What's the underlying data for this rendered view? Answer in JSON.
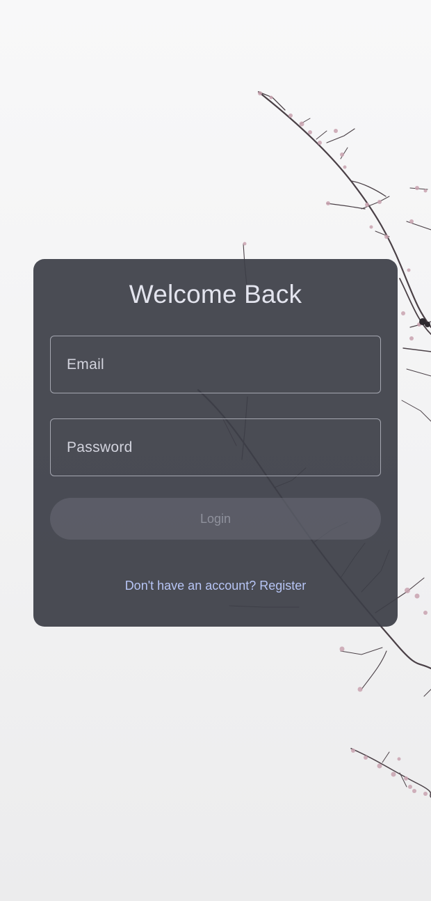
{
  "login": {
    "title": "Welcome Back",
    "email_placeholder": "Email",
    "password_placeholder": "Password",
    "login_label": "Login",
    "register_prompt": "Don't have an account? Register"
  },
  "background": {
    "image": "blossom-branch-photo",
    "color": "#f5f5f6"
  },
  "colors": {
    "card": "#3c3e47",
    "title_text": "#e3e4ee",
    "field_border": "#a5a7b1",
    "button_bg": "#5a5c66",
    "button_text": "#8f919c",
    "link": "#b7c5f5"
  }
}
